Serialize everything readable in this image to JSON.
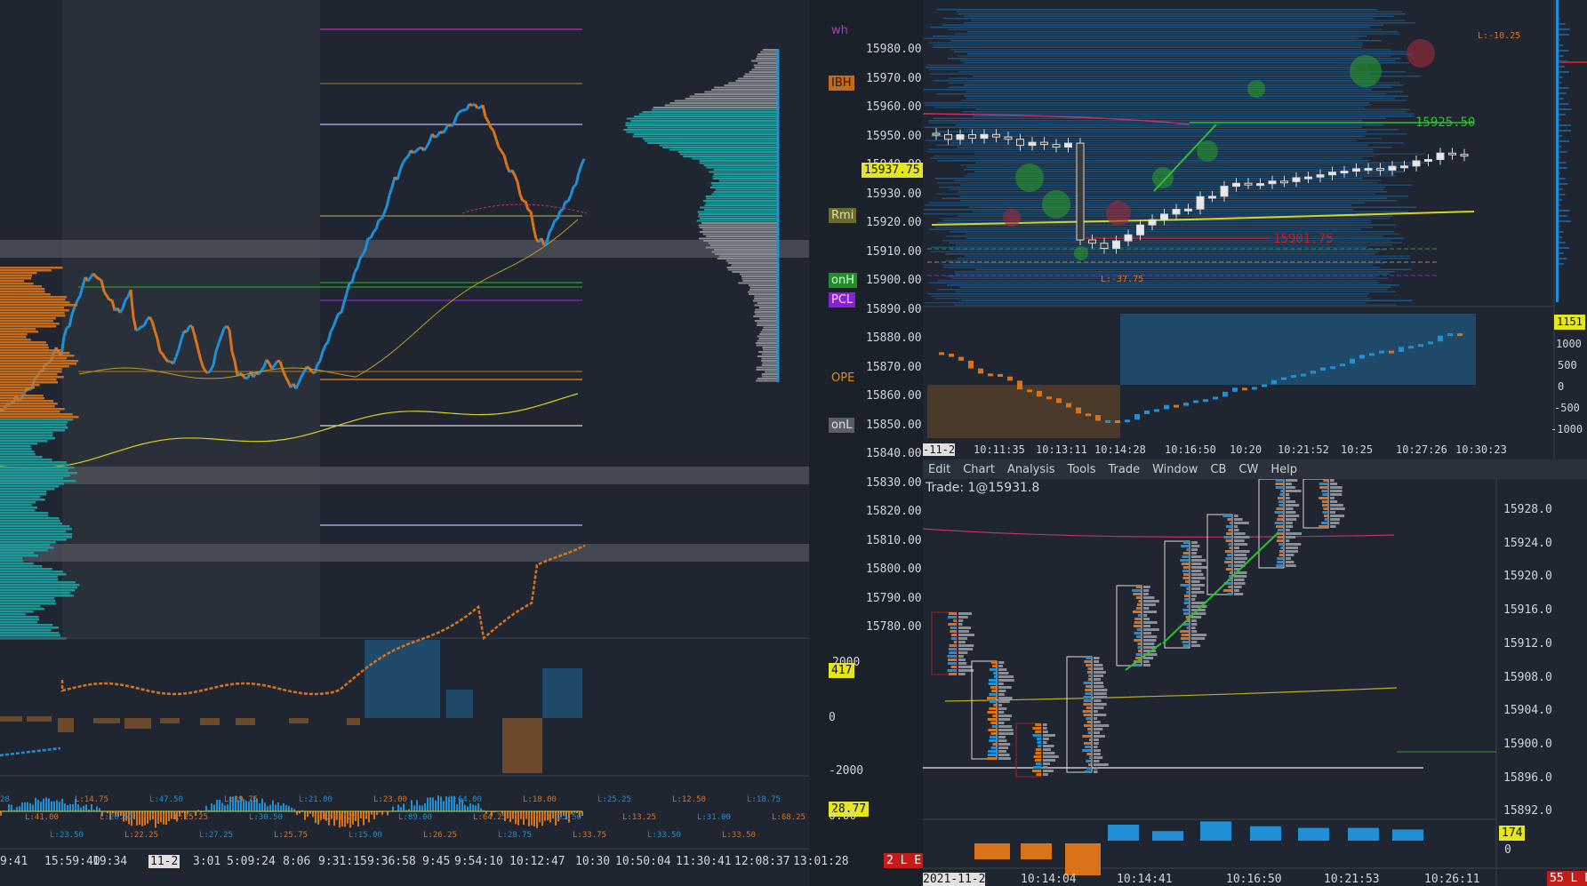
{
  "left": {
    "price_axis": [
      "15980.00",
      "15970.00",
      "15960.00",
      "15950.00",
      "15940.00",
      "15930.00",
      "15920.00",
      "15910.00",
      "15900.00",
      "15890.00",
      "15880.00",
      "15870.00",
      "15860.00",
      "15850.00",
      "15840.00",
      "15830.00",
      "15820.00",
      "15810.00",
      "15800.00",
      "15790.00",
      "15780.00"
    ],
    "current_price": "15937.75",
    "level_tags": {
      "wh": "wh",
      "ibh": "IBH",
      "rmi": "Rmi",
      "onh": "onH",
      "pcl": "PCL",
      "ope": "OPE",
      "onl": "onL"
    },
    "delta_axis": [
      "2000",
      "0",
      "-2000"
    ],
    "delta_value": "417",
    "cum_axis": [
      "0.00"
    ],
    "cum_value": "28.77",
    "cum_labels": [
      "28",
      "L:41.00",
      "L:23.50",
      "L:14.75",
      "L:20.50",
      "L:22.25",
      "L:47.50",
      "L:25.25",
      "L:27.25",
      "L:39.75",
      "L:30.50",
      "L:25.75",
      "L:21.00",
      "L:21.25",
      "L:15.00",
      "L:23.00",
      "L:89.00",
      "L:26.25",
      "L:64.00",
      "L:64.25",
      "L:28.75",
      "L:18.00",
      "L:25.50",
      "L:33.75",
      "L:25.25",
      "L:13.25",
      "L:33.50",
      "L:12.50",
      "L:31.00",
      "L:33.50",
      "L:18.75",
      "L:68.25"
    ],
    "time_axis": [
      "9:41",
      "15:59:40",
      "19:34",
      "11-2",
      "3:01",
      "5:09:24",
      "8:06",
      "9:31:15",
      "9:36:58",
      "9:45",
      "9:54:10",
      "10:12:47",
      "10:30",
      "10:50:04",
      "11:30:41",
      "12:08:37",
      "13:01:28"
    ],
    "badge": "2 L E"
  },
  "top_right": {
    "labels": {
      "l_top": "L:-10.25",
      "level_green": "15925.50",
      "level_red": "15901.75",
      "l_bottom": "L:-37.75"
    },
    "delta_axis": [
      "1151",
      "1000",
      "500",
      "0",
      "-500",
      "-1000"
    ],
    "time_axis": [
      "-11-2",
      "10:11:35",
      "10:13:11",
      "10:14:28",
      "10:16:50",
      "10:20",
      "10:21:52",
      "10:25",
      "10:27:26",
      "10:30:23"
    ]
  },
  "menu": [
    "Edit",
    "Chart",
    "Analysis",
    "Tools",
    "Trade",
    "Window",
    "CB",
    "CW",
    "Help"
  ],
  "bottom_right": {
    "trade_info": "Trade: 1@15931.8",
    "price_axis": [
      "15928.0",
      "15924.0",
      "15920.0",
      "15916.0",
      "15912.0",
      "15908.0",
      "15904.0",
      "15900.0",
      "15896.0",
      "15892.0"
    ],
    "volume_value": "174",
    "volume_axis": "0",
    "time_axis": [
      "2021-11-2",
      "10:14:04",
      "10:14:41",
      "10:16:50",
      "10:21:53",
      "10:26:11"
    ],
    "badge": "55 L E"
  },
  "colors": {
    "bg": "#1f2631",
    "buy": "#1f8fd6",
    "sell": "#d9731a",
    "profile_teal": "#1aa3a3",
    "yellow": "#e6d21e",
    "red": "#d11d1d",
    "green": "#2bd02b"
  }
}
